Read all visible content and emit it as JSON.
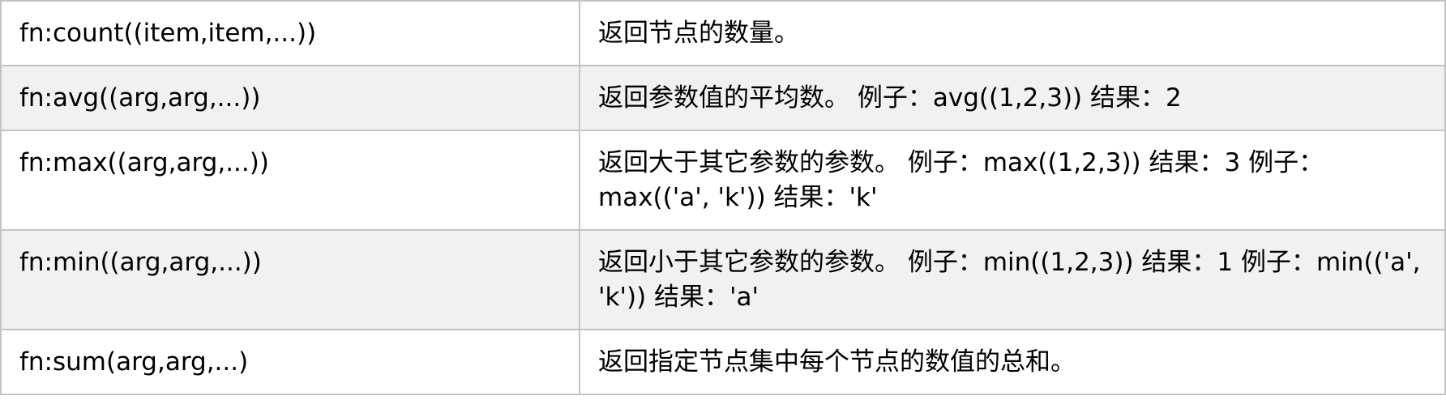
{
  "rows": [
    {
      "function": "fn:count((item,item,...))",
      "description": "返回节点的数量。"
    },
    {
      "function": "fn:avg((arg,arg,...))",
      "description": "返回参数值的平均数。 例子：avg((1,2,3)) 结果：2"
    },
    {
      "function": "fn:max((arg,arg,...))",
      "description": "返回大于其它参数的参数。 例子：max((1,2,3)) 结果：3 例子：max(('a', 'k')) 结果：'k'"
    },
    {
      "function": "fn:min((arg,arg,...))",
      "description": "返回小于其它参数的参数。 例子：min((1,2,3)) 结果：1 例子：min(('a', 'k')) 结果：'a'"
    },
    {
      "function": "fn:sum(arg,arg,...)",
      "description": "返回指定节点集中每个节点的数值的总和。"
    }
  ]
}
